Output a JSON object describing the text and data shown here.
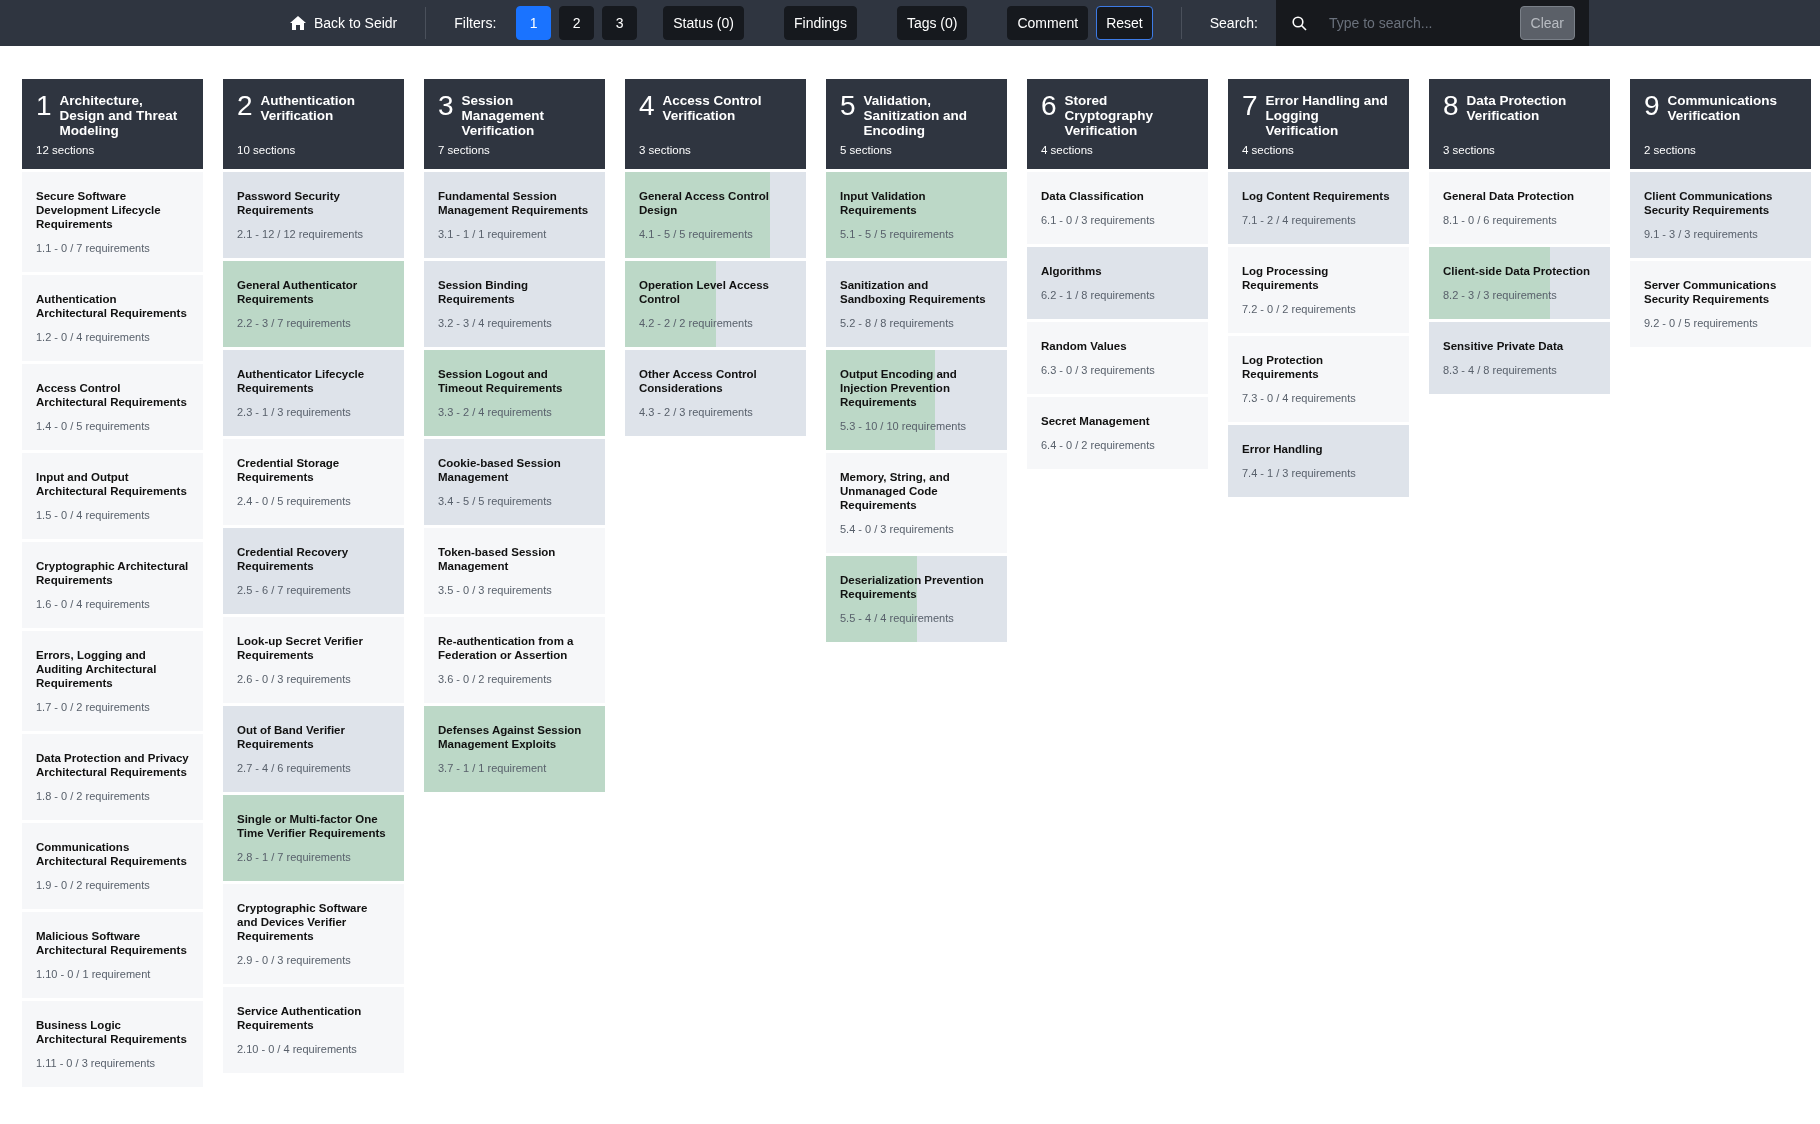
{
  "nav": {
    "back_label": "Back to Seidr",
    "filters_label": "Filters:",
    "filters": [
      {
        "label": "1",
        "selected": true
      },
      {
        "label": "2",
        "selected": false
      },
      {
        "label": "3",
        "selected": false
      }
    ],
    "buttons": [
      {
        "label": "Status (0)",
        "focused": false
      },
      {
        "label": "Findings",
        "focused": false
      },
      {
        "label": "Tags (0)",
        "focused": false
      },
      {
        "label": "Comment",
        "focused": false
      },
      {
        "label": "Reset",
        "focused": true
      }
    ],
    "search_label": "Search:",
    "search": {
      "placeholder": "Type to search..."
    },
    "clear": {
      "label": "Clear",
      "disabled": true
    }
  },
  "chapters": [
    {
      "number": "1",
      "title": "Architecture, Design and Threat Modeling",
      "count": "12 sections",
      "sections": [
        {
          "title": "Secure Software Development Lifecycle Requirements",
          "meta": "1.1 - 0 / 7 requirements",
          "started": false
        },
        {
          "title": "Authentication Architectural Requirements",
          "meta": "1.2 - 0 / 4 requirements",
          "started": false
        },
        {
          "title": "Access Control Architectural Requirements",
          "meta": "1.4 - 0 / 5 requirements",
          "started": false
        },
        {
          "title": "Input and Output Architectural Requirements",
          "meta": "1.5 - 0 / 4 requirements",
          "started": false
        },
        {
          "title": "Cryptographic Architectural Requirements",
          "meta": "1.6 - 0 / 4 requirements",
          "started": false
        },
        {
          "title": "Errors, Logging and Auditing Architectural Requirements",
          "meta": "1.7 - 0 / 2 requirements",
          "started": false
        },
        {
          "title": "Data Protection and Privacy Architectural Requirements",
          "meta": "1.8 - 0 / 2 requirements",
          "started": false
        },
        {
          "title": "Communications Architectural Requirements",
          "meta": "1.9 - 0 / 2 requirements",
          "started": false
        },
        {
          "title": "Malicious Software Architectural Requirements",
          "meta": "1.10 - 0 / 1 requirement",
          "started": false
        },
        {
          "title": "Business Logic Architectural Requirements",
          "meta": "1.11 - 0 / 3 requirements",
          "started": false
        }
      ]
    },
    {
      "number": "2",
      "title": "Authentication Verification",
      "count": "10 sections",
      "sections": [
        {
          "title": "Password Security Requirements",
          "meta": "2.1 - 12 / 12 requirements",
          "started": true
        },
        {
          "title": "General Authenticator Requirements",
          "meta": "2.2 - 3 / 7 requirements",
          "started": true,
          "complete": true
        },
        {
          "title": "Authenticator Lifecycle Requirements",
          "meta": "2.3 - 1 / 3 requirements",
          "started": true
        },
        {
          "title": "Credential Storage Requirements",
          "meta": "2.4 - 0 / 5 requirements",
          "started": false
        },
        {
          "title": "Credential Recovery Requirements",
          "meta": "2.5 - 6 / 7 requirements",
          "started": true
        },
        {
          "title": "Look-up Secret Verifier Requirements",
          "meta": "2.6 - 0 / 3 requirements",
          "started": false
        },
        {
          "title": "Out of Band Verifier Requirements",
          "meta": "2.7 - 4 / 6 requirements",
          "started": true
        },
        {
          "title": "Single or Multi-factor One Time Verifier Requirements",
          "meta": "2.8 - 1 / 7 requirements",
          "started": true,
          "complete": true
        },
        {
          "title": "Cryptographic Software and Devices Verifier Requirements",
          "meta": "2.9 - 0 / 3 requirements",
          "started": false
        },
        {
          "title": "Service Authentication Requirements",
          "meta": "2.10 - 0 / 4 requirements",
          "started": false
        }
      ]
    },
    {
      "number": "3",
      "title": "Session Management Verification",
      "count": "7 sections",
      "sections": [
        {
          "title": "Fundamental Session Management Requirements",
          "meta": "3.1 - 1 / 1 requirement",
          "started": true
        },
        {
          "title": "Session Binding Requirements",
          "meta": "3.2 - 3 / 4 requirements",
          "started": true
        },
        {
          "title": "Session Logout and Timeout Requirements",
          "meta": "3.3 - 2 / 4 requirements",
          "started": true,
          "complete": true
        },
        {
          "title": "Cookie-based Session Management",
          "meta": "3.4 - 5 / 5 requirements",
          "started": true
        },
        {
          "title": "Token-based Session Management",
          "meta": "3.5 - 0 / 3 requirements",
          "started": false
        },
        {
          "title": "Re-authentication from a Federation or Assertion",
          "meta": "3.6 - 0 / 2 requirements",
          "started": false
        },
        {
          "title": "Defenses Against Session Management Exploits",
          "meta": "3.7 - 1 / 1 requirement",
          "started": true,
          "complete": true
        }
      ]
    },
    {
      "number": "4",
      "title": "Access Control Verification",
      "count": "3 sections",
      "sections": [
        {
          "title": "General Access Control Design",
          "meta": "4.1 - 5 / 5 requirements",
          "started": true,
          "level": 0.8
        },
        {
          "title": "Operation Level Access Control",
          "meta": "4.2 - 2 / 2 requirements",
          "started": true,
          "level": 0.5
        },
        {
          "title": "Other Access Control Considerations",
          "meta": "4.3 - 2 / 3 requirements",
          "started": true
        }
      ]
    },
    {
      "number": "5",
      "title": "Validation, Sanitization and Encoding",
      "count": "5 sections",
      "sections": [
        {
          "title": "Input Validation Requirements",
          "meta": "5.1 - 5 / 5 requirements",
          "started": true,
          "complete": true
        },
        {
          "title": "Sanitization and Sandboxing Requirements",
          "meta": "5.2 - 8 / 8 requirements",
          "started": true
        },
        {
          "title": "Output Encoding and Injection Prevention Requirements",
          "meta": "5.3 - 10 / 10 requirements",
          "started": true,
          "level": 0.6
        },
        {
          "title": "Memory, String, and Unmanaged Code Requirements",
          "meta": "5.4 - 0 / 3 requirements",
          "started": false
        },
        {
          "title": "Deserialization Prevention Requirements",
          "meta": "5.5 - 4 / 4 requirements",
          "started": true,
          "level": 0.5
        }
      ]
    },
    {
      "number": "6",
      "title": "Stored Cryptography Verification",
      "count": "4 sections",
      "sections": [
        {
          "title": "Data Classification",
          "meta": "6.1 - 0 / 3 requirements",
          "started": false
        },
        {
          "title": "Algorithms",
          "meta": "6.2 - 1 / 8 requirements",
          "started": true
        },
        {
          "title": "Random Values",
          "meta": "6.3 - 0 / 3 requirements",
          "started": false
        },
        {
          "title": "Secret Management",
          "meta": "6.4 - 0 / 2 requirements",
          "started": false
        }
      ]
    },
    {
      "number": "7",
      "title": "Error Handling and Logging Verification",
      "count": "4 sections",
      "sections": [
        {
          "title": "Log Content Requirements",
          "meta": "7.1 - 2 / 4 requirements",
          "started": true
        },
        {
          "title": "Log Processing Requirements",
          "meta": "7.2 - 0 / 2 requirements",
          "started": false
        },
        {
          "title": "Log Protection Requirements",
          "meta": "7.3 - 0 / 4 requirements",
          "started": false
        },
        {
          "title": "Error Handling",
          "meta": "7.4 - 1 / 3 requirements",
          "started": true
        }
      ]
    },
    {
      "number": "8",
      "title": "Data Protection Verification",
      "count": "3 sections",
      "sections": [
        {
          "title": "General Data Protection",
          "meta": "8.1 - 0 / 6 requirements",
          "started": false
        },
        {
          "title": "Client-side Data Protection",
          "meta": "8.2 - 3 / 3 requirements",
          "started": true,
          "level": 0.67
        },
        {
          "title": "Sensitive Private Data",
          "meta": "8.3 - 4 / 8 requirements",
          "started": true
        }
      ]
    },
    {
      "number": "9",
      "title": "Communications Verification",
      "count": "2 sections",
      "sections": [
        {
          "title": "Client Communications Security Requirements",
          "meta": "9.1 - 3 / 3 requirements",
          "started": true
        },
        {
          "title": "Server Communications Security Requirements",
          "meta": "9.2 - 0 / 5 requirements",
          "started": false
        }
      ]
    }
  ]
}
